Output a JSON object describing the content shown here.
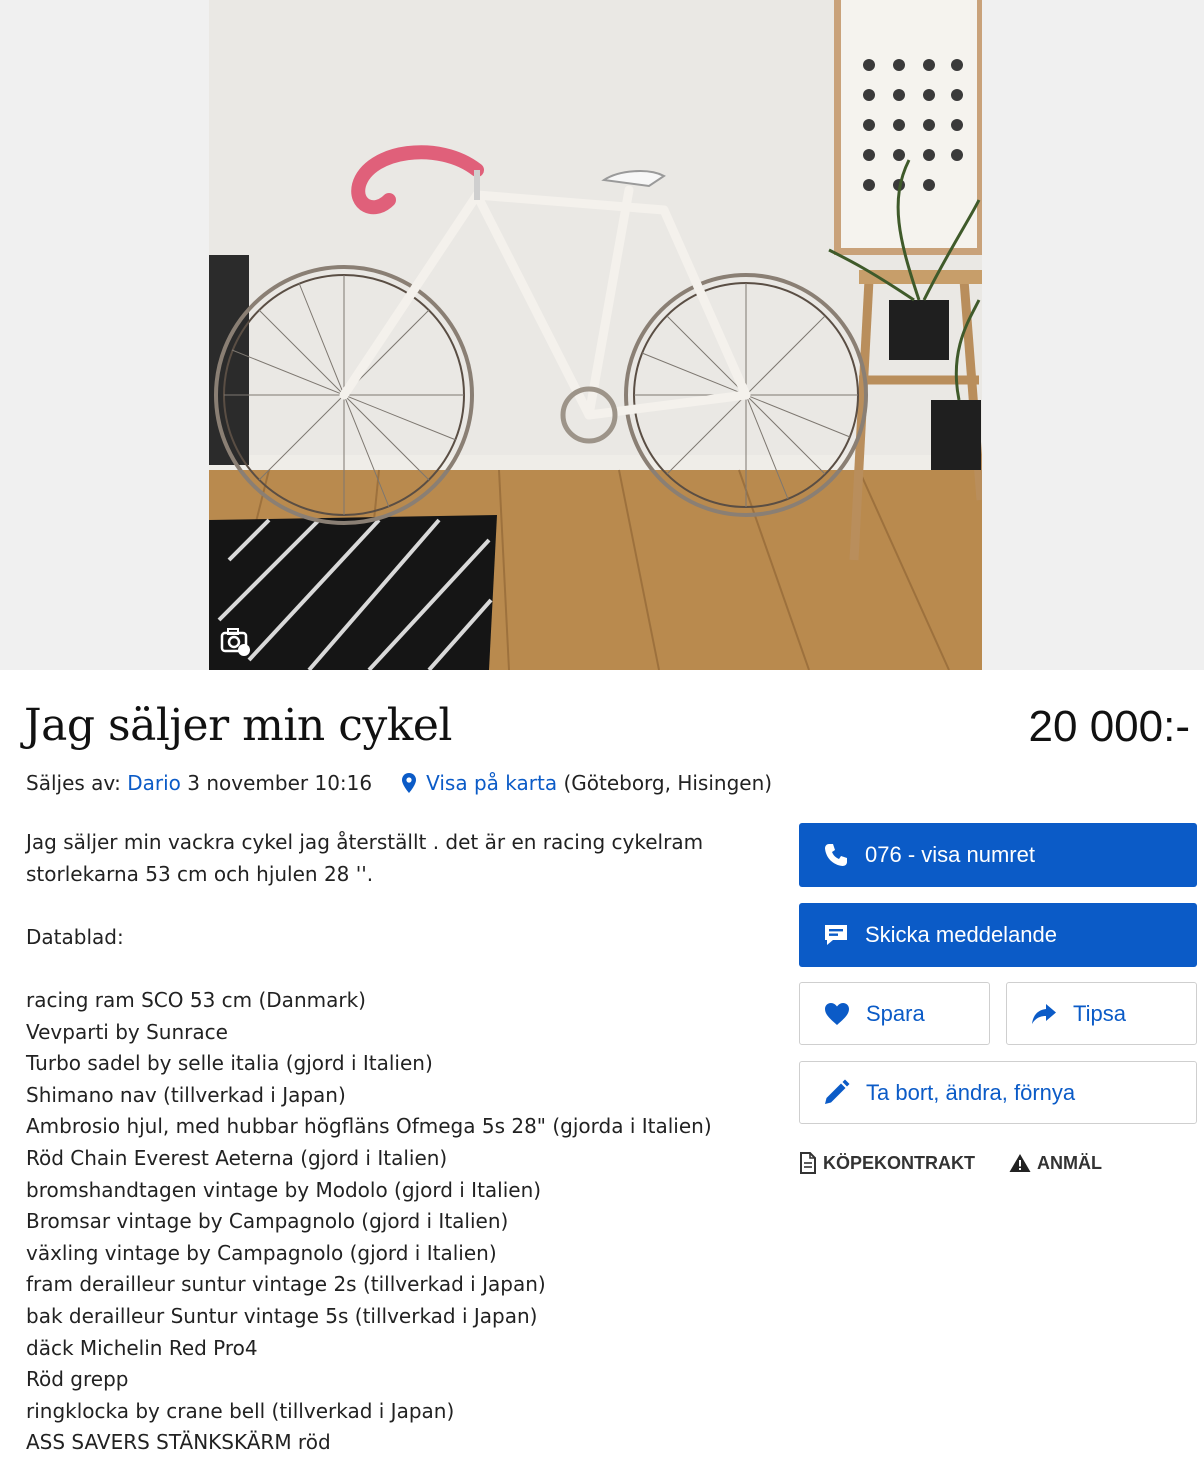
{
  "listing": {
    "title": "Jag säljer min cykel",
    "price": "20 000:-"
  },
  "meta": {
    "sold_by_label": "Säljes av:",
    "seller": "Dario",
    "date": "3 november 10:16",
    "map_link": "Visa på karta",
    "location": "(Göteborg, Hisingen)"
  },
  "description": {
    "intro": [
      "Jag säljer min vackra cykel jag återställt . det är en racing cykelram",
      "storlekarna 53 cm och hjulen 28 ''."
    ],
    "spec_heading": "Datablad:",
    "specs": [
      "racing ram SCO 53 cm (Danmark)",
      "Vevparti by Sunrace",
      "Turbo sadel by selle italia (gjord i Italien)",
      "Shimano nav (tillverkad i Japan)",
      "Ambrosio hjul, med hubbar högfläns Ofmega 5s 28\" (gjorda i Italien)",
      "Röd Chain Everest Aeterna (gjord i Italien)",
      "bromshandtagen vintage by Modolo (gjord i Italien)",
      "Bromsar vintage by Campagnolo (gjord i Italien)",
      "växling vintage by Campagnolo (gjord i Italien)",
      "fram derailleur suntur vintage 2s (tillverkad i Japan)",
      "bak derailleur Suntur vintage 5s (tillverkad i Japan)",
      "däck Michelin Red Pro4",
      "Röd grepp",
      "ringklocka by crane bell (tillverkad i Japan)",
      "ASS SAVERS STÄNKSKÄRM röd"
    ]
  },
  "actions": {
    "phone": "076 - visa numret",
    "message": "Skicka meddelande",
    "save": "Spara",
    "share": "Tipsa",
    "edit": "Ta bort, ändra, förnya",
    "contract": "KÖPEKONTRAKT",
    "report": "ANMÄL"
  },
  "colors": {
    "accent": "#0b5bc7",
    "page_bg": "#ffffff",
    "gallery_bg": "#f0f0f0"
  },
  "icons": {
    "phone": "phone-icon",
    "message": "chat-icon",
    "save": "heart-icon",
    "share": "share-arrow-icon",
    "edit": "pencil-icon",
    "contract": "document-icon",
    "report": "warning-icon",
    "map": "map-pin-icon",
    "image_badge": "camera-icon"
  }
}
